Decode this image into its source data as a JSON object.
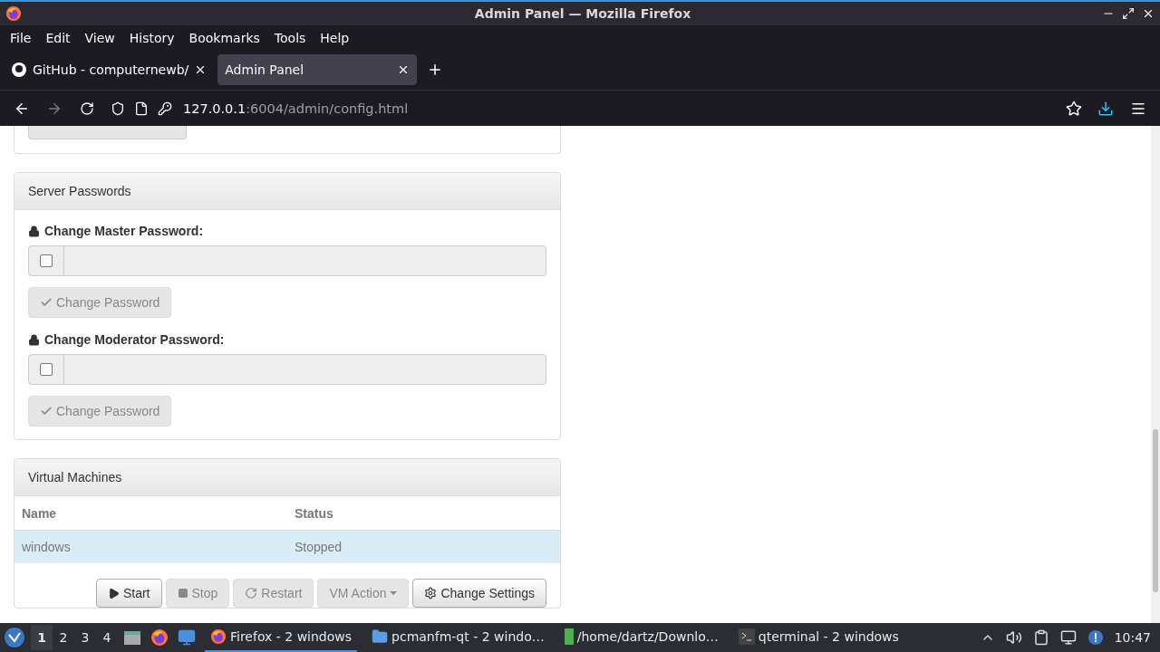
{
  "window": {
    "title": "Admin Panel — Mozilla Firefox"
  },
  "menu": [
    "File",
    "Edit",
    "View",
    "History",
    "Bookmarks",
    "Tools",
    "Help"
  ],
  "tabs": [
    {
      "label": "GitHub - computernewb/",
      "selected": false
    },
    {
      "label": "Admin Panel",
      "selected": true
    }
  ],
  "url": {
    "host": "127.0.0.1",
    "rest": ":6004/admin/config.html"
  },
  "passwords": {
    "title": "Server Passwords",
    "fields": [
      {
        "label": "Change Master Password:",
        "checked": false,
        "button": "Change Password",
        "disabled": true
      },
      {
        "label": "Change Moderator Password:",
        "checked": false,
        "button": "Change Password",
        "disabled": true
      }
    ]
  },
  "vms": {
    "title": "Virtual Machines",
    "columns": [
      "Name",
      "Status"
    ],
    "rows": [
      {
        "cells": [
          "windows",
          "Stopped"
        ],
        "selected": true
      }
    ],
    "actions": [
      {
        "kind": "play",
        "label": "Start",
        "disabled": false
      },
      {
        "kind": "stop",
        "label": "Stop",
        "disabled": true
      },
      {
        "kind": "restart",
        "label": "Restart",
        "disabled": true
      },
      {
        "kind": "dropdown",
        "label": "VM Action",
        "disabled": true
      },
      {
        "kind": "gear",
        "label": "Change Settings",
        "disabled": false
      }
    ]
  },
  "taskbar": {
    "workspaces": [
      {
        "label": "1",
        "selected": true
      },
      {
        "label": "2",
        "selected": false
      },
      {
        "label": "3",
        "selected": false
      },
      {
        "label": "4",
        "selected": false
      }
    ],
    "tasks": [
      {
        "kind": "firefox",
        "label": "Firefox - 2 windows",
        "selected": true
      },
      {
        "kind": "folder",
        "label": "pcmanfm-qt - 2 windo…",
        "selected": false
      },
      {
        "kind": "green",
        "label": "/home/dartz/Downlo…",
        "selected": false
      },
      {
        "kind": "terminal",
        "label": "qterminal - 2 windows",
        "selected": false
      }
    ],
    "clock": "10:47"
  }
}
